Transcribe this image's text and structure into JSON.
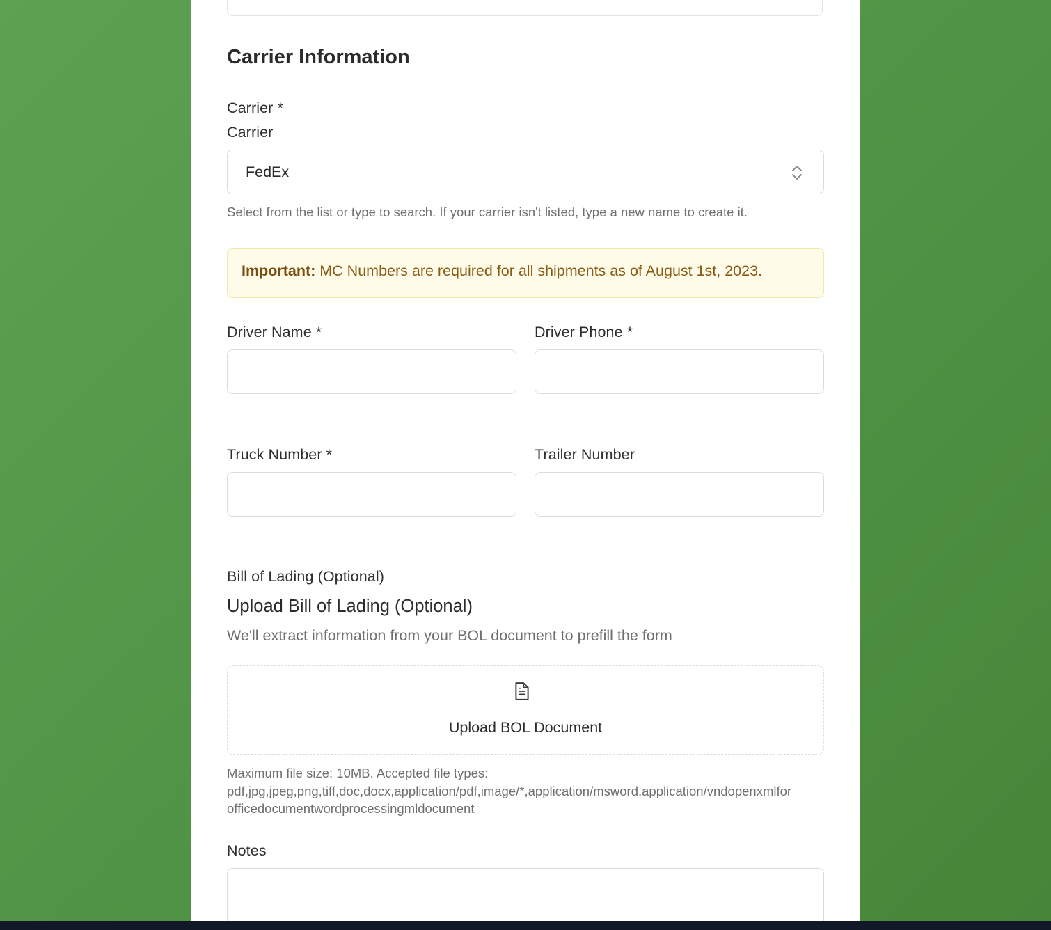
{
  "section": {
    "title": "Carrier Information"
  },
  "carrier": {
    "label": "Carrier *",
    "sublabel": "Carrier",
    "selected_value": "FedEx",
    "hint": "Select from the list or type to search. If your carrier isn't listed, type a new name to create it."
  },
  "notice": {
    "strong": "Important:",
    "text": " MC Numbers are required for all shipments as of August 1st, 2023."
  },
  "fields": {
    "driver_name_label": "Driver Name *",
    "driver_name_value": "",
    "driver_phone_label": "Driver Phone *",
    "driver_phone_value": "",
    "truck_number_label": "Truck Number *",
    "truck_number_value": "",
    "trailer_number_label": "Trailer Number",
    "trailer_number_value": ""
  },
  "bol": {
    "label": "Bill of Lading (Optional)",
    "upload_title": "Upload Bill of Lading (Optional)",
    "upload_desc": "We'll extract information from your BOL document to prefill the form",
    "upload_button": "Upload BOL Document",
    "icon": "file-text-icon",
    "file_hint_line1": "Maximum file size: 10MB. Accepted file types:",
    "file_hint_line2": "pdf,jpg,jpeg,png,tiff,doc,docx,application/pdf,image/*,application/msword,application/vndopenxmlfor",
    "file_hint_line3": "officedocumentwordprocessingmldocument"
  },
  "notes": {
    "label": "Notes",
    "value": ""
  },
  "colors": {
    "background_green": "#519447",
    "notice_bg": "#fefce8",
    "notice_text": "#8a5a16"
  }
}
